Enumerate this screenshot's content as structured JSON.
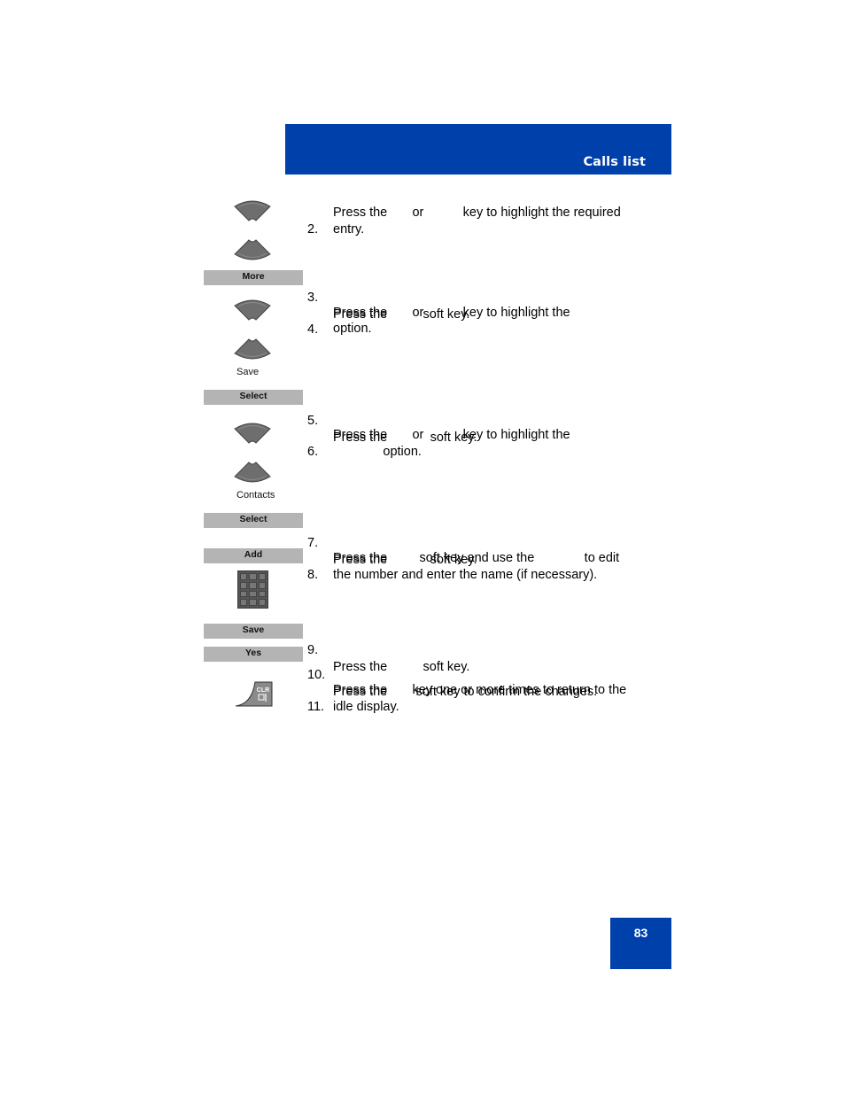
{
  "header": {
    "title": "Calls list"
  },
  "page": {
    "number": "83"
  },
  "softkeys": {
    "more": "More",
    "select1": "Select",
    "select2": "Select",
    "add": "Add",
    "save": "Save",
    "yes": "Yes"
  },
  "option_labels": {
    "save": "Save",
    "contacts": "Contacts"
  },
  "icons": {
    "nav_up": "navigation-up-key-icon",
    "nav_down": "navigation-down-key-icon",
    "keypad": "dial-keypad-icon",
    "clear": "clr-end-key-icon"
  },
  "steps": [
    {
      "num": "2.",
      "lines": [
        "Press the       or           key to highlight the required",
        "entry."
      ]
    },
    {
      "num": "3.",
      "lines": [
        "Press the          soft key."
      ]
    },
    {
      "num": "4.",
      "lines": [
        "Press the       or           key to highlight the",
        "option."
      ]
    },
    {
      "num": "5.",
      "lines": [
        "Press the            soft key."
      ]
    },
    {
      "num": "6.",
      "lines": [
        "Press the       or           key to highlight the",
        "              option."
      ]
    },
    {
      "num": "7.",
      "lines": [
        "Press the            soft key."
      ]
    },
    {
      "num": "8.",
      "lines": [
        "Press the         soft key and use the              to edit",
        "the number and enter the name (if necessary)."
      ]
    },
    {
      "num": "9.",
      "lines": [
        "Press the          soft key."
      ]
    },
    {
      "num": "10.",
      "lines": [
        "Press the        soft key to confirm the changes."
      ]
    },
    {
      "num": "11.",
      "lines": [
        "Press the       key one or more times to return to the",
        "idle display."
      ]
    }
  ],
  "colors": {
    "accent": "#0040ab",
    "softkey_bg": "#b4b4b4",
    "key_gray": "#6e6e6e"
  }
}
